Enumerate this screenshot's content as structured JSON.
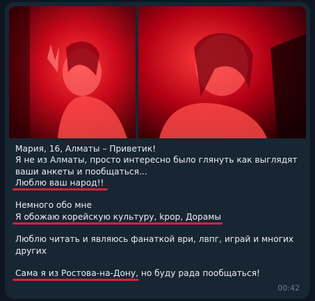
{
  "message": {
    "lines": [
      "Мария, 16, Алматы – Приветик!",
      "Я не из Алматы, просто интересно было глянуть как выглядят",
      "ваши анкеты и пообщаться...",
      "Люблю ваш народ!!",
      "",
      "Немного обо мне",
      "Я обожаю корейскую культуру, kpop, Дорамы",
      "",
      "Люблю читать и являюсь фанаткой ври, лвпг, играй и многих",
      "других",
      "",
      "Сама я из Ростова-на-Дону, но буду рада пообщаться!"
    ],
    "time": "00:42"
  },
  "photos": [
    {
      "name": "photo-1",
      "tint": "#e8132a"
    },
    {
      "name": "photo-2",
      "tint": "#e8132a"
    }
  ],
  "colors": {
    "bubble": "#182533",
    "background": "#0e1621",
    "underline": "#e0203a",
    "text": "#e9eef3",
    "timestamp": "#6d7f8f"
  }
}
